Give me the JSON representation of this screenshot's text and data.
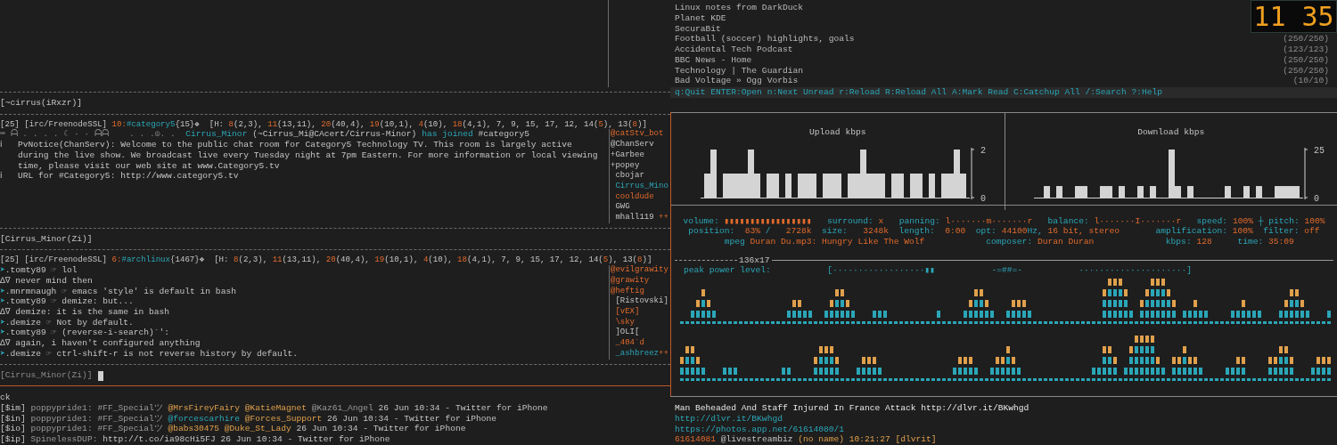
{
  "left": {
    "status_1": "[~cirrus(iRxzr)]",
    "window_1": {
      "header": [
        {
          "t": "[25] [irc/FreenodeSSL] "
        },
        {
          "t": "10:",
          "kind": "accent"
        },
        {
          "t": "#category5",
          "kind": "link"
        },
        {
          "t": "{15}❖  [H: "
        },
        {
          "t": "8",
          "kind": "accent"
        },
        {
          "t": "(2,3), "
        },
        {
          "t": "11",
          "kind": "accent"
        },
        {
          "t": "(13,11), "
        },
        {
          "t": "20",
          "kind": "accent"
        },
        {
          "t": "(40,4), "
        },
        {
          "t": "19",
          "kind": "accent"
        },
        {
          "t": "(10,1), "
        },
        {
          "t": "4",
          "kind": "accent"
        },
        {
          "t": "(10), "
        },
        {
          "t": "18",
          "kind": "accent"
        },
        {
          "t": "(4,1), 7, 9, 15, 17, 12, 14("
        },
        {
          "t": "5",
          "kind": "accent"
        },
        {
          "t": "), 13("
        },
        {
          "t": "8",
          "kind": "accent"
        },
        {
          "t": ")]"
        }
      ],
      "messages": [
        {
          "kind": "join",
          "prefix": "⌨ ᗩ . . . . ☾ · · ᗩᗩ    . . .☮. .",
          "segs": [
            {
              "t": "Cirrus_Minor",
              "kind": "link"
            },
            {
              "t": " (~Cirrus_Mi@CAcert/Cirrus-Minor) "
            },
            {
              "t": "has joined",
              "kind": "link"
            },
            {
              "t": " #category5"
            }
          ]
        },
        {
          "kind": "info",
          "icon": "ℹ",
          "text": "PvNotice(ChanServ): Welcome to the public chat room for Category5 Technology TV.  This room is largely active during the live show.  We broadcast live every Tuesday night at 7pm Eastern.  For more information or local viewing time, please visit our web site at www.Category5.tv"
        },
        {
          "kind": "info",
          "icon": "ℹ",
          "text": "URL for #Category5: http://www.category5.tv"
        }
      ],
      "nicklist": [
        [
          {
            "t": "@catStv_bot",
            "kind": "accent"
          }
        ],
        [
          {
            "t": "@ChanServ"
          }
        ],
        [
          {
            "t": "+Garbee"
          }
        ],
        [
          {
            "t": "+popey"
          }
        ],
        [
          {
            "t": " cbojar"
          }
        ],
        [
          {
            "t": " Cirrus_Mino",
            "kind": "link"
          }
        ],
        [
          {
            "t": " cooldude",
            "kind": "accent"
          }
        ],
        [
          {
            "t": " GWG"
          }
        ],
        [
          {
            "t": " mhall119 "
          },
          {
            "t": "++",
            "kind": "accent"
          }
        ]
      ]
    },
    "status_2": "[Cirrus_Minor(Zi)]",
    "window_2": {
      "header": [
        {
          "t": "[25] [irc/FreenodeSSL] "
        },
        {
          "t": "6:",
          "kind": "accent"
        },
        {
          "t": "#archlinux",
          "kind": "link"
        },
        {
          "t": "{1467}❖  [H: "
        },
        {
          "t": "8",
          "kind": "accent"
        },
        {
          "t": "(2,3), "
        },
        {
          "t": "11",
          "kind": "accent"
        },
        {
          "t": "(13,11), "
        },
        {
          "t": "20",
          "kind": "accent"
        },
        {
          "t": "(40,4), "
        },
        {
          "t": "19",
          "kind": "accent"
        },
        {
          "t": "(10,1), "
        },
        {
          "t": "4",
          "kind": "accent"
        },
        {
          "t": "(10), "
        },
        {
          "t": "18",
          "kind": "accent"
        },
        {
          "t": "(4,1), 7, 9, 15, 17, 12, 14("
        },
        {
          "t": "5",
          "kind": "accent"
        },
        {
          "t": "), 13("
        },
        {
          "t": "8",
          "kind": "accent"
        },
        {
          "t": ")]"
        }
      ],
      "messages": [
        {
          "kind": "nick",
          "arrow": "➤",
          "nick": ".tomty89",
          "sep": "☞",
          "text": "lol"
        },
        {
          "kind": "cont",
          "mark": "∆∇",
          "text": "never mind then"
        },
        {
          "kind": "nick",
          "arrow": "➤",
          "nick": ".mnrmnaugh",
          "sep": "☞",
          "text": "emacs 'style' is default in bash"
        },
        {
          "kind": "nick",
          "arrow": "➤",
          "nick": ".tomty89",
          "sep": "☞",
          "text": "demize: but..."
        },
        {
          "kind": "cont",
          "mark": "∆∇",
          "text": "demize: it is the same in bash"
        },
        {
          "kind": "nick",
          "arrow": "➤",
          "nick": ".demize",
          "sep": "☞",
          "text": "Not by default."
        },
        {
          "kind": "nick",
          "arrow": "➤",
          "nick": ".tomty89",
          "sep": "☞",
          "text": "(reverse-i-search)`':"
        },
        {
          "kind": "cont",
          "mark": "∆∇",
          "text": "again, i haven't configured anything"
        },
        {
          "kind": "nick",
          "arrow": "➤",
          "nick": ".demize",
          "sep": "☞",
          "text": "ctrl-shift-r is not reverse history by default."
        }
      ],
      "nicklist": [
        [
          {
            "t": "@evilgrawity",
            "kind": "accent"
          }
        ],
        [
          {
            "t": "@grawity",
            "kind": "accent"
          }
        ],
        [
          {
            "t": "@heftig",
            "kind": "accent"
          }
        ],
        [
          {
            "t": " [Ristovski]"
          }
        ],
        [
          {
            "t": " [vEX]",
            "kind": "accent"
          }
        ],
        [
          {
            "t": " \\sky",
            "kind": "accent"
          }
        ],
        [
          {
            "t": " ]OLI["
          }
        ],
        [
          {
            "t": " _404`d",
            "kind": "accent"
          }
        ],
        [
          {
            "t": " _ashbreez",
            "kind": "link"
          },
          {
            "t": "++",
            "kind": "accent"
          }
        ]
      ]
    },
    "input_prompt": "[Cirrus_Minor(Zi)]",
    "twitter_lines": [
      [
        {
          "t": "ck"
        }
      ],
      [
        {
          "t": "[$im] "
        },
        {
          "t": "poppypride1: #FF_Specialツ ",
          "kind": "muted"
        },
        {
          "t": "@MrsFireyFairy @KatieMagnet ",
          "kind": "mention"
        },
        {
          "t": "@Kaz61_Angel ",
          "kind": "muted"
        },
        {
          "t": "26 Jun 10:34 - Twitter for iPhone"
        }
      ],
      [
        {
          "t": "[$in] "
        },
        {
          "t": "poppypride1: #FF_Specialツ ",
          "kind": "muted"
        },
        {
          "t": "@forcescarhire ",
          "kind": "link"
        },
        {
          "t": "@Forces_Support ",
          "kind": "mention"
        },
        {
          "t": "26 Jun 10:34 - Twitter for iPhone"
        }
      ],
      [
        {
          "t": "[$io] "
        },
        {
          "t": "poppypride1: #FF_Specialツ ",
          "kind": "muted"
        },
        {
          "t": "@babs30475 @Duke_St_Lady ",
          "kind": "mention"
        },
        {
          "t": "26 Jun 10:34 - Twitter for iPhone"
        }
      ],
      [
        {
          "t": "[$ip] "
        },
        {
          "t": "SpinelessDUP: ",
          "kind": "muted"
        },
        {
          "t": "http://t.co/ia98cHi5FJ 26 Jun 10:34 - Twitter for iPhone"
        }
      ]
    ]
  },
  "right": {
    "clock": "11 35",
    "feeds": [
      {
        "title": "Linux notes from DarkDuck"
      },
      {
        "title": "Planet KDE"
      },
      {
        "title": "SecuraBit"
      },
      {
        "title": "Football (soccer) highlights, goals",
        "count": "(250/250)"
      },
      {
        "title": "Accidental Tech Podcast",
        "count": "(123/123)"
      },
      {
        "title": "BBC News - Home",
        "count": "(250/250)"
      },
      {
        "title": "Technology | The Guardian",
        "count": "(250/250)"
      },
      {
        "title": "Bad Voltage » Ogg Vorbis",
        "count": "(10/10)"
      }
    ],
    "help_bar": "q:Quit ENTER:Open n:Next Unread r:Reload R:Reload All A:Mark Read C:Catchup All /:Search ?:Help",
    "upload": {
      "chart_data": {
        "type": "bar",
        "title": "Upload kbps",
        "ylim": [
          0,
          2
        ],
        "yticks": [
          0,
          2
        ],
        "values": [
          1,
          2,
          0,
          1,
          1,
          1,
          1,
          2,
          1,
          0,
          1,
          1,
          0,
          1,
          0,
          1,
          1,
          1,
          0,
          1,
          1,
          1,
          0,
          1,
          1,
          2,
          1,
          1,
          1,
          0,
          1,
          1,
          0,
          1,
          1,
          0,
          1,
          0,
          1,
          1,
          2,
          1
        ]
      }
    },
    "download": {
      "chart_data": {
        "type": "bar",
        "title": "Download kbps",
        "ylim": [
          0,
          25
        ],
        "yticks": [
          0,
          25
        ],
        "values": [
          0,
          6,
          0,
          6,
          0,
          0,
          6,
          6,
          0,
          0,
          6,
          6,
          0,
          6,
          0,
          0,
          6,
          0,
          6,
          0,
          0,
          25,
          6,
          0,
          6,
          0,
          0,
          0,
          0,
          0,
          6,
          0,
          0,
          6,
          0,
          6,
          0,
          0,
          6,
          6,
          6,
          6
        ]
      }
    },
    "player_lines": [
      [
        {
          "t": "volume: ",
          "kind": "link"
        },
        {
          "t": "▮▮▮▮▮▮▮▮▮▮▮▮▮▮▮▮▮",
          "kind": "accent"
        },
        {
          "t": "   surround: ",
          "kind": "link"
        },
        {
          "t": "x",
          "kind": "accent"
        },
        {
          "t": "   panning: ",
          "kind": "link"
        },
        {
          "t": "l·······m·······r",
          "kind": "accent"
        },
        {
          "t": "   balance: ",
          "kind": "link"
        },
        {
          "t": "l·······I·······r",
          "kind": "accent"
        },
        {
          "t": "   speed: ",
          "kind": "link"
        },
        {
          "t": "100%",
          "kind": "accent"
        },
        {
          "t": " ┼ pitch: ",
          "kind": "link"
        },
        {
          "t": "100%",
          "kind": "accent"
        }
      ],
      [
        {
          "t": "position:  ",
          "kind": "link"
        },
        {
          "t": "83%",
          "kind": "accent"
        },
        {
          "t": " /   ",
          "kind": "link"
        },
        {
          "t": "2728k",
          "kind": "accent"
        },
        {
          "t": "  size:   ",
          "kind": "link"
        },
        {
          "t": "3248k",
          "kind": "accent"
        },
        {
          "t": "  length:  ",
          "kind": "link"
        },
        {
          "t": "0:00",
          "kind": "accent"
        },
        {
          "t": "  opt: ",
          "kind": "link"
        },
        {
          "t": "44100",
          "kind": "accent"
        },
        {
          "t": "Hz, ",
          "kind": "link"
        },
        {
          "t": "16 bit, stereo",
          "kind": "accent"
        },
        {
          "t": "       amplification: ",
          "kind": "link"
        },
        {
          "t": "100%",
          "kind": "accent"
        },
        {
          "t": "  filter: ",
          "kind": "link"
        },
        {
          "t": "off",
          "kind": "accent"
        }
      ],
      [
        {
          "t": "  mpeg ",
          "kind": "link"
        },
        {
          "t": "Duran Du.mp3: Hungry Like The Wolf",
          "kind": "accent"
        },
        {
          "t": "            composer: ",
          "kind": "link"
        },
        {
          "t": "Duran Duran",
          "kind": "accent"
        },
        {
          "t": "              kbps: ",
          "kind": "link"
        },
        {
          "t": "128",
          "kind": "accent"
        },
        {
          "t": "     time: ",
          "kind": "link"
        },
        {
          "t": "35:09",
          "kind": "accent"
        }
      ]
    ],
    "divider_label": "136x17",
    "peak_power": [
      {
        "t": "peak power level:",
        "kind": "link"
      },
      {
        "t": "           [··················▮▮           -=##=-           ·····················]",
        "kind": "link"
      }
    ],
    "news_lines": [
      [
        {
          "t": "Man Beheaded And Staff Injured In France Attack http://dlvr.it/BKwhgd",
          "kind": "bright"
        }
      ],
      [
        {
          "t": "http://dlvr.it/BKwhgd",
          "kind": "link"
        }
      ],
      [
        {
          "t": "https://photos.app.net/61614080/1",
          "kind": "link"
        }
      ],
      [
        {
          "t": "61614081",
          "kind": "accent"
        },
        {
          "t": " @livestreambiz"
        },
        {
          "t": " (no name) 10:21:27 [dlvrit]",
          "kind": "mention"
        }
      ]
    ]
  }
}
